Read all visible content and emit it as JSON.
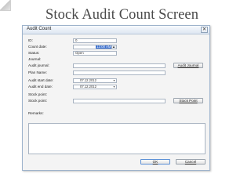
{
  "slide": {
    "title": "Stock Audit Count Screen"
  },
  "window": {
    "title": "Audit Count",
    "close_glyph": "✕"
  },
  "form": {
    "id": {
      "label": "ID:",
      "value": "0"
    },
    "count_date": {
      "label": "Count date:",
      "value": "12:00 AM",
      "spin_glyph": "▲▼"
    },
    "status": {
      "label": "Status:",
      "value": "Open"
    },
    "journal_section": {
      "label": "Journal:"
    },
    "audit_journal": {
      "label": "Audit journal:",
      "value": "",
      "button": "Audit Journal"
    },
    "plan_name": {
      "label": "Plan Name:",
      "value": ""
    },
    "audit_start_date": {
      "label": "Audit start date:",
      "value": "07.12.2012"
    },
    "audit_end_date": {
      "label": "Audit end date:",
      "value": "07.12.2012"
    },
    "stock_point_section": {
      "label": "Stock point:"
    },
    "stock_point": {
      "label": "Stock point:",
      "value": "",
      "button": "Stock Point"
    },
    "remarks": {
      "label": "Remarks:",
      "value": ""
    },
    "dropdown_glyph": "▾"
  },
  "footer": {
    "ok_label": "OK",
    "cancel_label": "Cancel"
  }
}
